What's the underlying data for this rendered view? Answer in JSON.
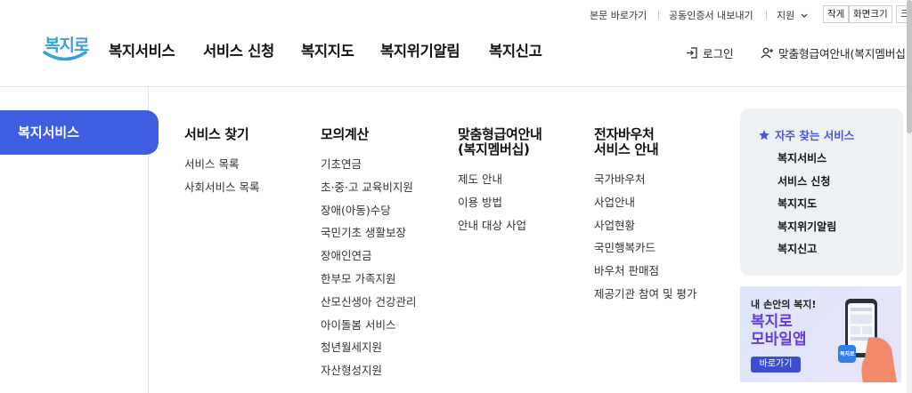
{
  "utility": {
    "skip_link": "본문 바로가기",
    "cert_export": "공동인증서 내보내기",
    "support": "지원",
    "font_small": "작게",
    "font_size": "화면크기",
    "font_large": "크"
  },
  "header": {
    "logo_text": "복지로",
    "gnb": [
      "복지서비스",
      "서비스 신청",
      "복지지도",
      "복지위기알림",
      "복지신고"
    ],
    "login": "로그인",
    "membership": "맞춤형급여안내(복지멤버십"
  },
  "menu": {
    "active": "복지서비스",
    "columns": [
      {
        "title": "서비스 찾기",
        "items": [
          "서비스 목록",
          "사회서비스 목록"
        ]
      },
      {
        "title": "모의계산",
        "items": [
          "기초연금",
          "초·중·고 교육비지원",
          "장애(아동)수당",
          "국민기초 생활보장",
          "장애인연금",
          "한부모 가족지원",
          "산모신생아 건강관리",
          "아이돌봄 서비스",
          "청년월세지원",
          "자산형성지원"
        ]
      },
      {
        "title_line1": "맞춤형급여안내",
        "title_line2": "(복지멤버십)",
        "items": [
          "제도 안내",
          "이용 방법",
          "안내 대상 사업"
        ]
      },
      {
        "title_line1": "전자바우처",
        "title_line2": "서비스 안내",
        "items": [
          "국가바우처",
          "사업안내",
          "사업현황",
          "국민행복카드",
          "바우처 판매점",
          "제공기관 참여 및 평가"
        ]
      }
    ]
  },
  "faq": {
    "title": "자주 찾는 서비스",
    "items": [
      "복지서비스",
      "서비스 신청",
      "복지지도",
      "복지위기알림",
      "복지신고"
    ]
  },
  "banner": {
    "sub": "내 손안의 복지!",
    "main_line1": "복지로",
    "main_line2": "모바일앱",
    "button": "바로가기",
    "phone_logo": "복지로"
  },
  "colors": {
    "brand_blue": "#3f5fe0",
    "faq_purple": "#4a55d9",
    "logo_blue": "#3aa0d8"
  }
}
